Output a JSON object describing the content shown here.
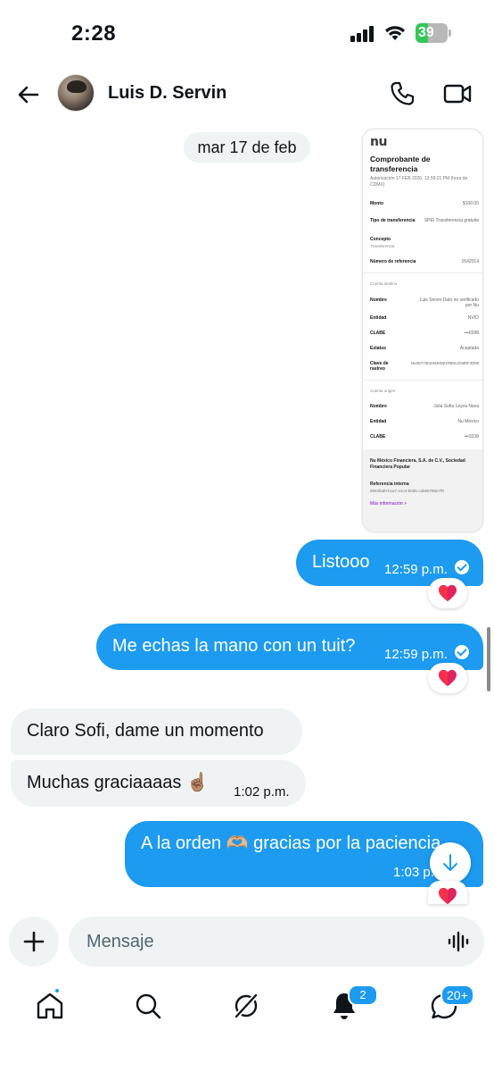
{
  "status_bar": {
    "time": "2:28",
    "battery_percent": 39,
    "battery_label": "39"
  },
  "header": {
    "contact_name": "Luis D. Servin"
  },
  "conversation": {
    "date_separator": "mar 17 de feb",
    "receipt": {
      "logo": "nu",
      "title": "Comprobante de transferencia",
      "subtitle": "Autorización 17 FEB 2026, 12:59:21 PM (hora de CDMX)",
      "rows": [
        {
          "key": "Monto",
          "value": "$100.00"
        },
        {
          "key": "Tipo de transferencia",
          "value": "SPEI Transferencia gratuita"
        },
        {
          "key": "Concepto",
          "value": "Transferencia"
        },
        {
          "key": "Número de referencia",
          "value": "1642014"
        },
        {
          "key": "Cuenta destino",
          "value": ""
        },
        {
          "key": "Nombre",
          "value": "Luis Servin Dato no verificado por Nu"
        },
        {
          "key": "Entidad",
          "value": "NVIO"
        },
        {
          "key": "CLABE",
          "value": "•••0398"
        },
        {
          "key": "Estatus",
          "value": "Aceptada"
        },
        {
          "key": "Clave de rastreo",
          "value": "NU36T7I63HN3I0QURBNLG58RF30N0"
        },
        {
          "key": "Cuenta origen",
          "value": ""
        },
        {
          "key": "Nombre",
          "value": "Julia Sofia Leyva Nava"
        },
        {
          "key": "Entidad",
          "value": "Nu México"
        },
        {
          "key": "CLABE",
          "value": "•••3238"
        }
      ],
      "footer_company": "Nu México Financiera, S.A. de C.V., Sociedad Financiera Popular",
      "footer_ref_label": "Referencia interna",
      "footer_ref_value": "6994fad0-bca7-41c3-b0d5-cab65786e7f0",
      "footer_more": "Más información  >"
    },
    "messages": [
      {
        "id": "m1",
        "direction": "out",
        "text": "Listooo",
        "time": "12:59 p.m.",
        "read": true,
        "reaction": "red-heart"
      },
      {
        "id": "m2",
        "direction": "out",
        "text": "Me echas la mano con un tuit?",
        "time": "12:59 p.m.",
        "read": true,
        "reaction": "red-heart"
      },
      {
        "id": "m3",
        "direction": "in",
        "text": "Claro Sofi, dame un momento",
        "time": ""
      },
      {
        "id": "m4",
        "direction": "in",
        "text": "Muchas graciaaaas ☝🏽",
        "time": "1:02 p.m."
      },
      {
        "id": "m5",
        "direction": "out",
        "text": "A la orden 🫶🏼 gracias por la paciencia",
        "time": "1:03 p.",
        "reaction": "red-heart"
      }
    ]
  },
  "composer": {
    "placeholder": "Mensaje"
  },
  "nav": {
    "notifications_badge": "2",
    "messages_badge": "20+"
  },
  "colors": {
    "accent": "#1d9bf0",
    "incoming_bubble": "#eff3f4",
    "battery_green": "#34c759"
  },
  "icons": {
    "back": "arrow-left-icon",
    "call": "phone-icon",
    "video": "video-camera-icon",
    "plus": "plus-icon",
    "voice": "waveform-icon",
    "home": "home-icon",
    "search": "search-icon",
    "grok": "grok-icon",
    "notifications": "bell-icon",
    "messages": "messages-icon",
    "scroll_down": "arrow-down-icon",
    "reaction": "heart-icon"
  }
}
